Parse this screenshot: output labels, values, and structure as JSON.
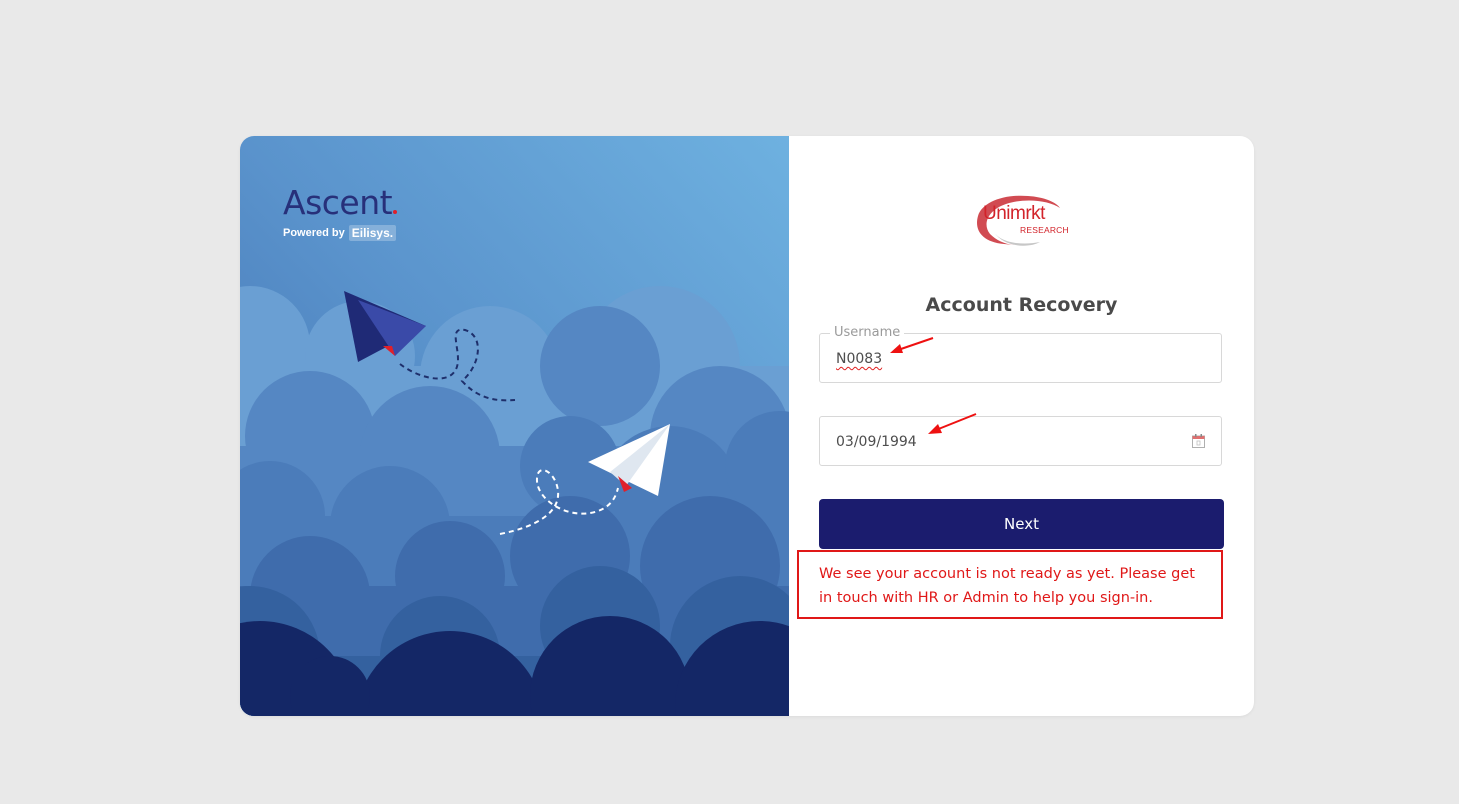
{
  "brand": {
    "name": "Ascent",
    "powered_by": "Powered by",
    "powered_company": "Eilisys."
  },
  "company_logo": {
    "name": "Unimrkt",
    "sub": "RESEARCH"
  },
  "form": {
    "title": "Account Recovery",
    "username_label": "Username",
    "username_value": "N0083",
    "dob_value": "03/09/1994",
    "next_label": "Next"
  },
  "error": {
    "message": "We see your account is not ready as yet. Please get in touch with HR or Admin to help you sign-in."
  },
  "colors": {
    "button": "#1b1c6e",
    "error": "#e01818",
    "brand_red": "#d2232a",
    "sky_top": "#6aaedd",
    "sky_bottom": "#27307a"
  }
}
